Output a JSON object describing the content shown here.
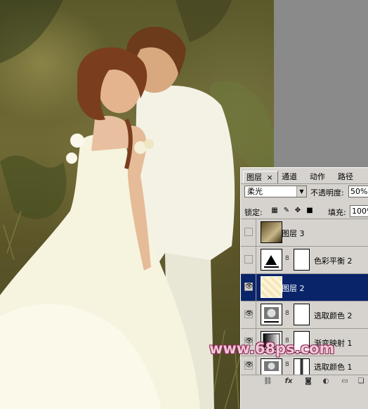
{
  "panel": {
    "tabs": [
      {
        "label": "图层",
        "close": "×"
      },
      {
        "label": "通道"
      },
      {
        "label": "动作"
      },
      {
        "label": "路径"
      }
    ],
    "blend_mode": "柔光",
    "opacity_label": "不透明度:",
    "opacity_value": "50%",
    "lock_label": "锁定:",
    "fill_label": "填充:",
    "fill_value": "100%",
    "layers": [
      {
        "name": "图层 3",
        "visible": false,
        "selected": false,
        "type": "image"
      },
      {
        "name": "色彩平衡 2",
        "visible": false,
        "selected": false,
        "type": "adjustment"
      },
      {
        "name": "图层 2",
        "visible": true,
        "selected": true,
        "type": "fill"
      },
      {
        "name": "选取颜色 2",
        "visible": true,
        "selected": false,
        "type": "adjustment"
      },
      {
        "name": "渐变映射 1",
        "visible": true,
        "selected": false,
        "type": "gradient"
      },
      {
        "name": "选取颜色 1",
        "visible": true,
        "selected": false,
        "type": "adjustment"
      }
    ],
    "bottom_icons": [
      "link-icon",
      "fx-icon",
      "mask-icon",
      "adjustment-icon",
      "folder-icon",
      "new-layer-icon"
    ]
  },
  "watermark": "www.68ps.com",
  "colors": {
    "selection": "#0a246a",
    "panel_bg": "#d6d3ce",
    "watermark": "#f2c7d8"
  }
}
